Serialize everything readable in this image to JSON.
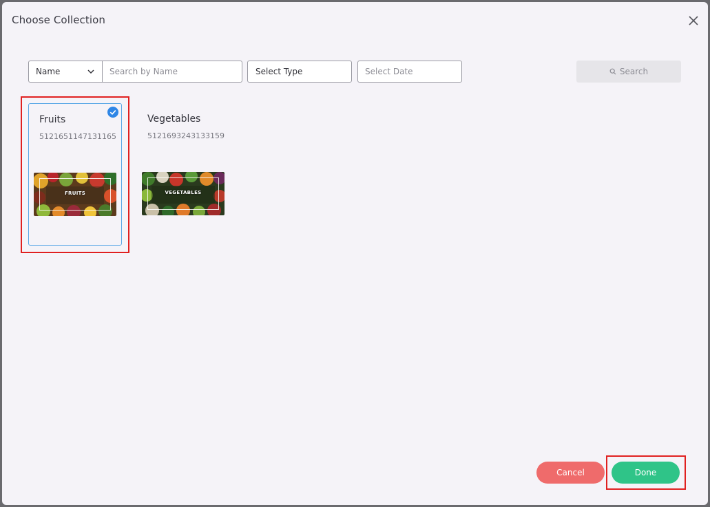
{
  "modal": {
    "title": "Choose Collection"
  },
  "filters": {
    "field_select": "Name",
    "search_placeholder": "Search by Name",
    "type_select": "Select Type",
    "date_placeholder": "Select Date",
    "search_button": "Search"
  },
  "collections": [
    {
      "name": "Fruits",
      "id": "5121651147131165",
      "thumb_label": "FRUITS",
      "selected": true
    },
    {
      "name": "Vegetables",
      "id": "5121693243133159",
      "thumb_label": "VEGETABLES",
      "selected": false
    }
  ],
  "footer": {
    "cancel": "Cancel",
    "done": "Done"
  },
  "colors": {
    "selected_border": "#5aa7e6",
    "cancel": "#ef6b6b",
    "done": "#2fc488",
    "highlight": "#e02020"
  }
}
